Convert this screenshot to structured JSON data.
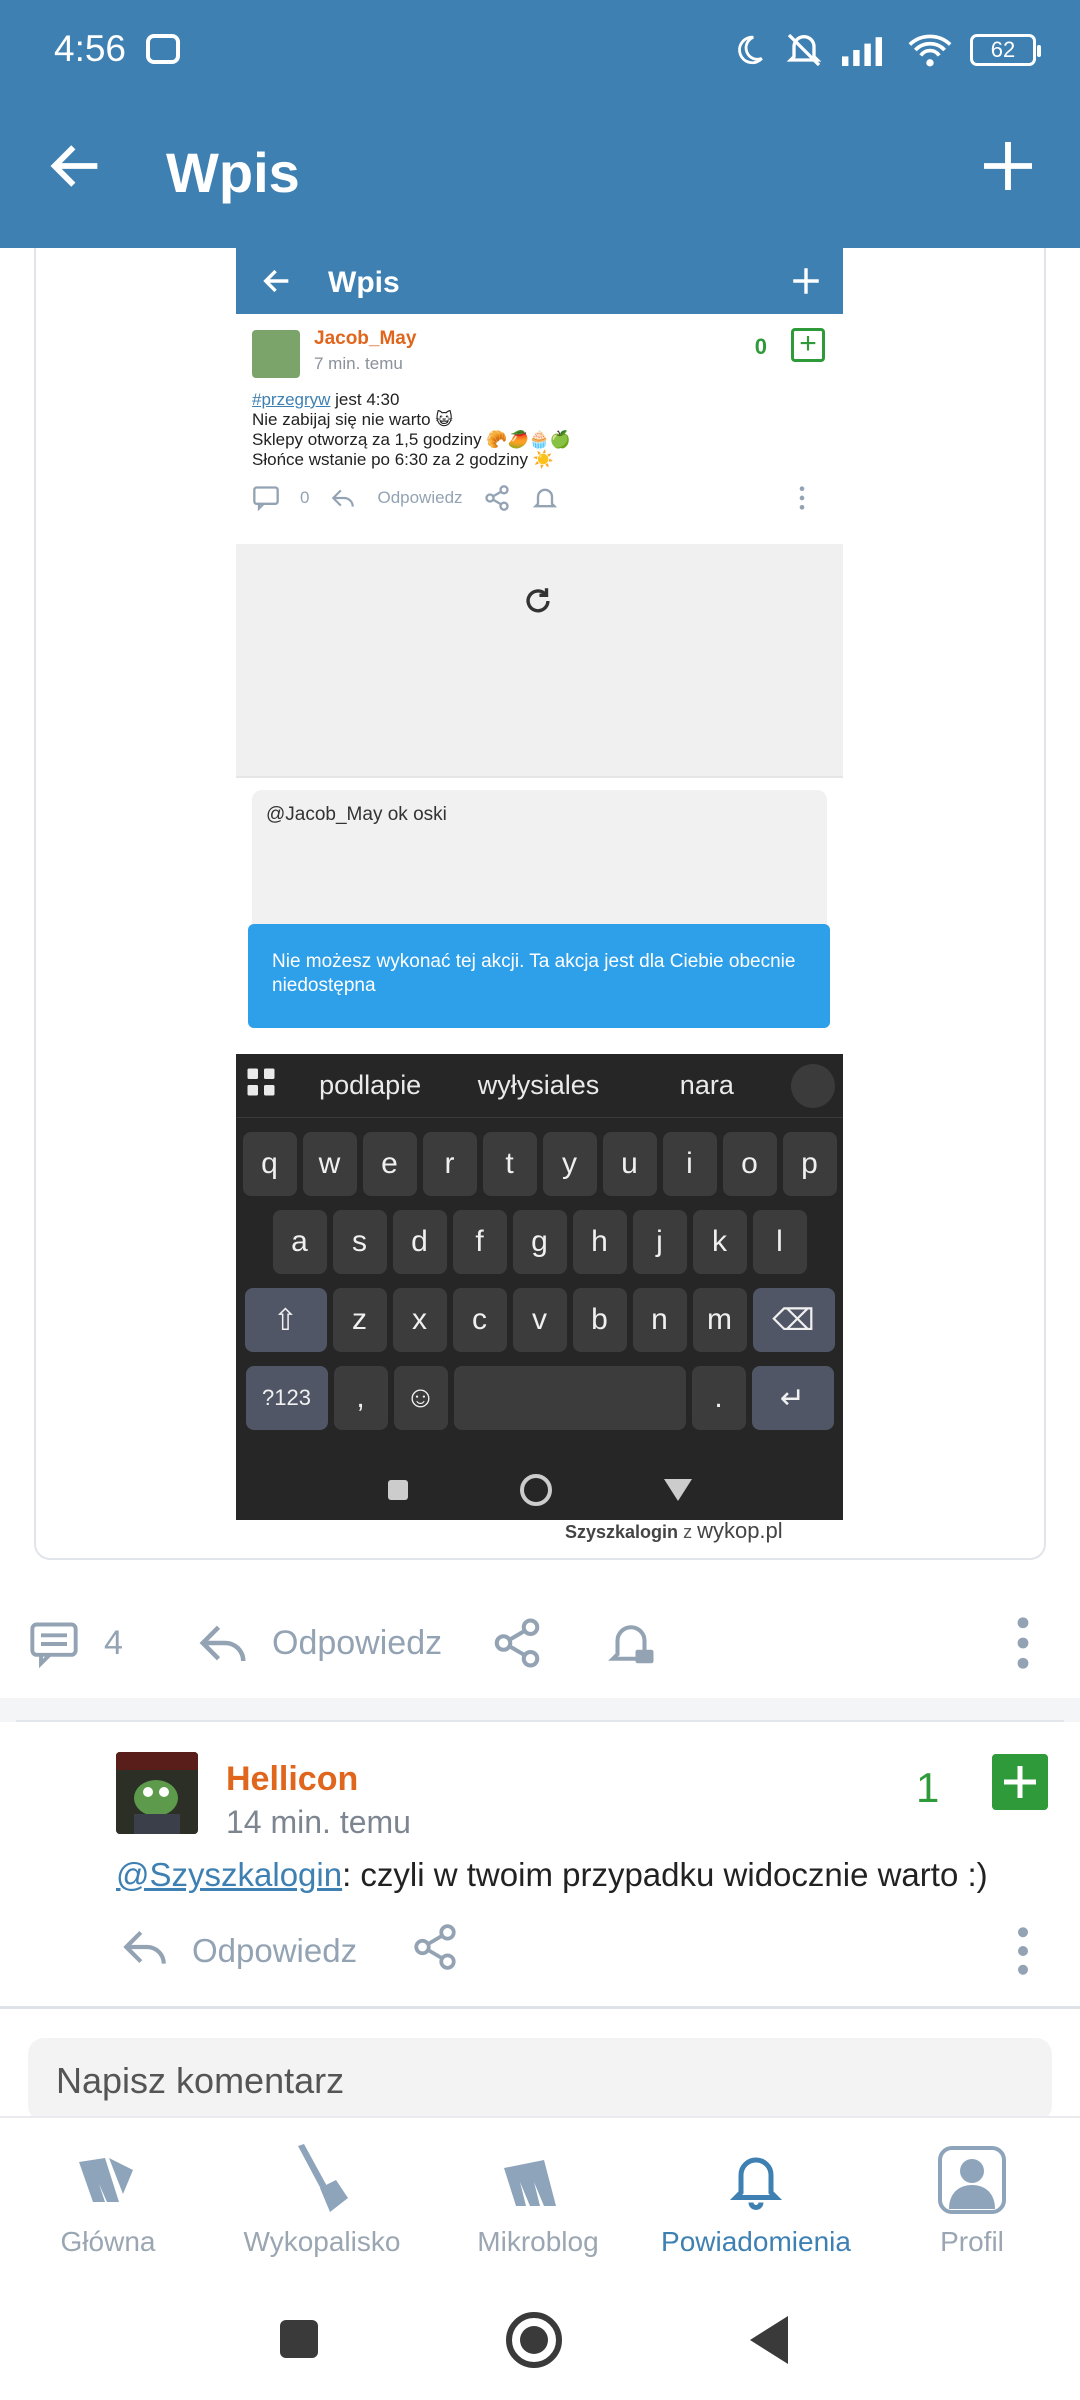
{
  "status": {
    "time": "4:56",
    "battery": "62"
  },
  "appbar": {
    "title": "Wpis"
  },
  "embedded": {
    "title": "Wpis",
    "author": "Jacob_May",
    "time": "7 min. temu",
    "score": "0",
    "lines": {
      "tag": "#przegryw",
      "l1_rest": " jest 4:30",
      "l2": "Nie zabijaj się nie warto 😺",
      "l3": "Sklepy otworzą za 1,5 godziny 🥐🥭🧁🍏",
      "l4": "Słońce wstanie po 6:30 za 2 godziny ☀️"
    },
    "actions": {
      "comments": "0",
      "reply": "Odpowiedz"
    },
    "input_text": "@Jacob_May ok oski",
    "toast": "Nie możesz wykonać tej akcji. Ta akcja jest dla Ciebie obecnie niedostępna",
    "keyboard": {
      "suggestions": [
        "podlapie",
        "wyłysiales",
        "nara"
      ],
      "row1": [
        "q",
        "w",
        "e",
        "r",
        "t",
        "y",
        "u",
        "i",
        "o",
        "p"
      ],
      "row2": [
        "a",
        "s",
        "d",
        "f",
        "g",
        "h",
        "j",
        "k",
        "l"
      ],
      "row3": [
        "z",
        "x",
        "c",
        "v",
        "b",
        "n",
        "m"
      ],
      "symbols": "?123",
      "comma": ",",
      "period": "."
    },
    "credit_user": "Szyszkalogin",
    "credit_mid": "z",
    "credit_site": "wykop.pl"
  },
  "post_actions": {
    "comments": "4",
    "reply": "Odpowiedz"
  },
  "comment": {
    "author": "Hellicon",
    "time": "14 min. temu",
    "score": "1",
    "mention": "@Szyszkalogin",
    "text": ": czyli w twoim przypadku widocznie warto :)",
    "reply": "Odpowiedz"
  },
  "composer": {
    "placeholder": "Napisz komentarz"
  },
  "nav": [
    {
      "label": "Główna"
    },
    {
      "label": "Wykopalisko"
    },
    {
      "label": "Mikroblog"
    },
    {
      "label": "Powiadomienia"
    },
    {
      "label": "Profil"
    }
  ],
  "colors": {
    "brand": "#3e80b2",
    "green": "#2f9a3a",
    "author": "#e0661d"
  }
}
